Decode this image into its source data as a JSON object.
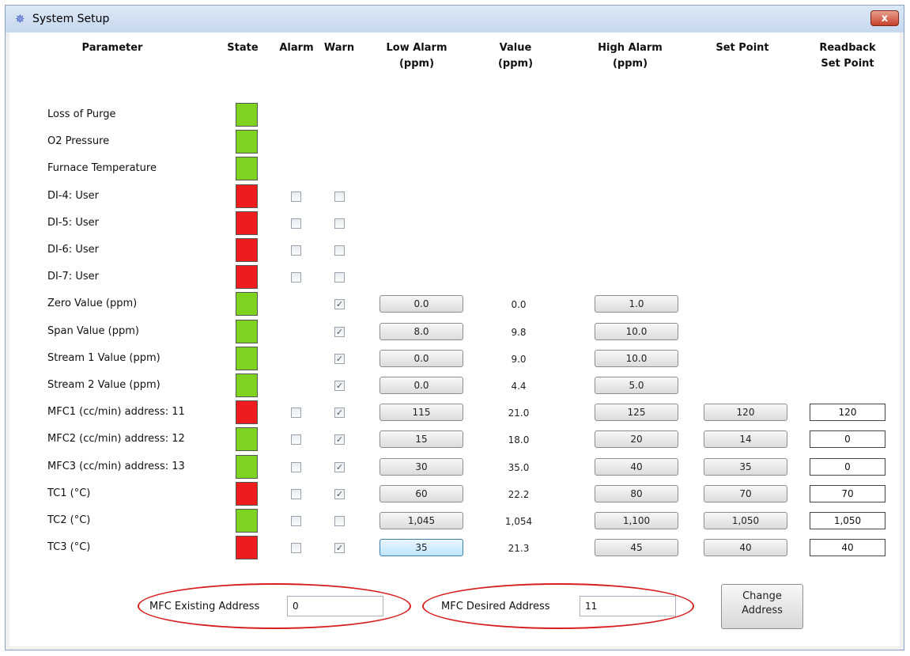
{
  "window": {
    "title": "System Setup",
    "close_glyph": "x",
    "icon": "app-gear-icon"
  },
  "headers": {
    "parameter": "Parameter",
    "state": "State",
    "alarm": "Alarm",
    "warn": "Warn",
    "low_alarm_1": "Low Alarm",
    "low_alarm_2": "(ppm)",
    "value_1": "Value",
    "value_2": "(ppm)",
    "high_alarm_1": "High Alarm",
    "high_alarm_2": "(ppm)",
    "set_point": "Set Point",
    "readback_1": "Readback",
    "readback_2": "Set Point"
  },
  "colors": {
    "green": "#7ed321",
    "red": "#ee1c1c"
  },
  "rows": [
    {
      "label": "Loss of Purge",
      "state": "green"
    },
    {
      "label": "O2 Pressure",
      "state": "green"
    },
    {
      "label": "Furnace Temperature",
      "state": "green"
    },
    {
      "label": "DI-4: User",
      "state": "red",
      "alarm": false,
      "warn": false
    },
    {
      "label": "DI-5: User",
      "state": "red",
      "alarm": false,
      "warn": false
    },
    {
      "label": "DI-6: User",
      "state": "red",
      "alarm": false,
      "warn": false
    },
    {
      "label": "DI-7: User",
      "state": "red",
      "alarm": false,
      "warn": false
    },
    {
      "label": "Zero Value (ppm)",
      "state": "green",
      "warn": true,
      "low": "0.0",
      "value": "0.0",
      "high": "1.0"
    },
    {
      "label": "Span Value (ppm)",
      "state": "green",
      "warn": true,
      "low": "8.0",
      "value": "9.8",
      "high": "10.0"
    },
    {
      "label": "Stream 1 Value (ppm)",
      "state": "green",
      "warn": true,
      "low": "0.0",
      "value": "9.0",
      "high": "10.0"
    },
    {
      "label": "Stream 2 Value (ppm)",
      "state": "green",
      "warn": true,
      "low": "0.0",
      "value": "4.4",
      "high": "5.0"
    },
    {
      "label": "MFC1 (cc/min)   address: 11",
      "state": "red",
      "alarm": false,
      "warn": true,
      "low": "115",
      "value": "21.0",
      "high": "125",
      "setpoint": "120",
      "readback": "120"
    },
    {
      "label": "MFC2 (cc/min)   address: 12",
      "state": "green",
      "alarm": false,
      "warn": true,
      "low": "15",
      "value": "18.0",
      "high": "20",
      "setpoint": "14",
      "readback": "0"
    },
    {
      "label": "MFC3 (cc/min)   address: 13",
      "state": "green",
      "alarm": false,
      "warn": true,
      "low": "30",
      "value": "35.0",
      "high": "40",
      "setpoint": "35",
      "readback": "0"
    },
    {
      "label": "TC1 (°C)",
      "state": "red",
      "alarm": false,
      "warn": true,
      "low": "60",
      "value": "22.2",
      "high": "80",
      "setpoint": "70",
      "readback": "70"
    },
    {
      "label": "TC2 (°C)",
      "state": "green",
      "alarm": false,
      "warn": false,
      "low": "1,045",
      "value": "1,054",
      "high": "1,100",
      "setpoint": "1,050",
      "readback": "1,050"
    },
    {
      "label": "TC3 (°C)",
      "state": "red",
      "alarm": false,
      "warn": true,
      "low": "35",
      "low_focused": true,
      "value": "21.3",
      "high": "45",
      "setpoint": "40",
      "readback": "40"
    }
  ],
  "address": {
    "existing_label": "MFC Existing Address",
    "existing_value": "0",
    "desired_label": "MFC Desired Address",
    "desired_value": "11",
    "change_btn_1": "Change",
    "change_btn_2": "Address"
  },
  "check_glyph": "✓"
}
